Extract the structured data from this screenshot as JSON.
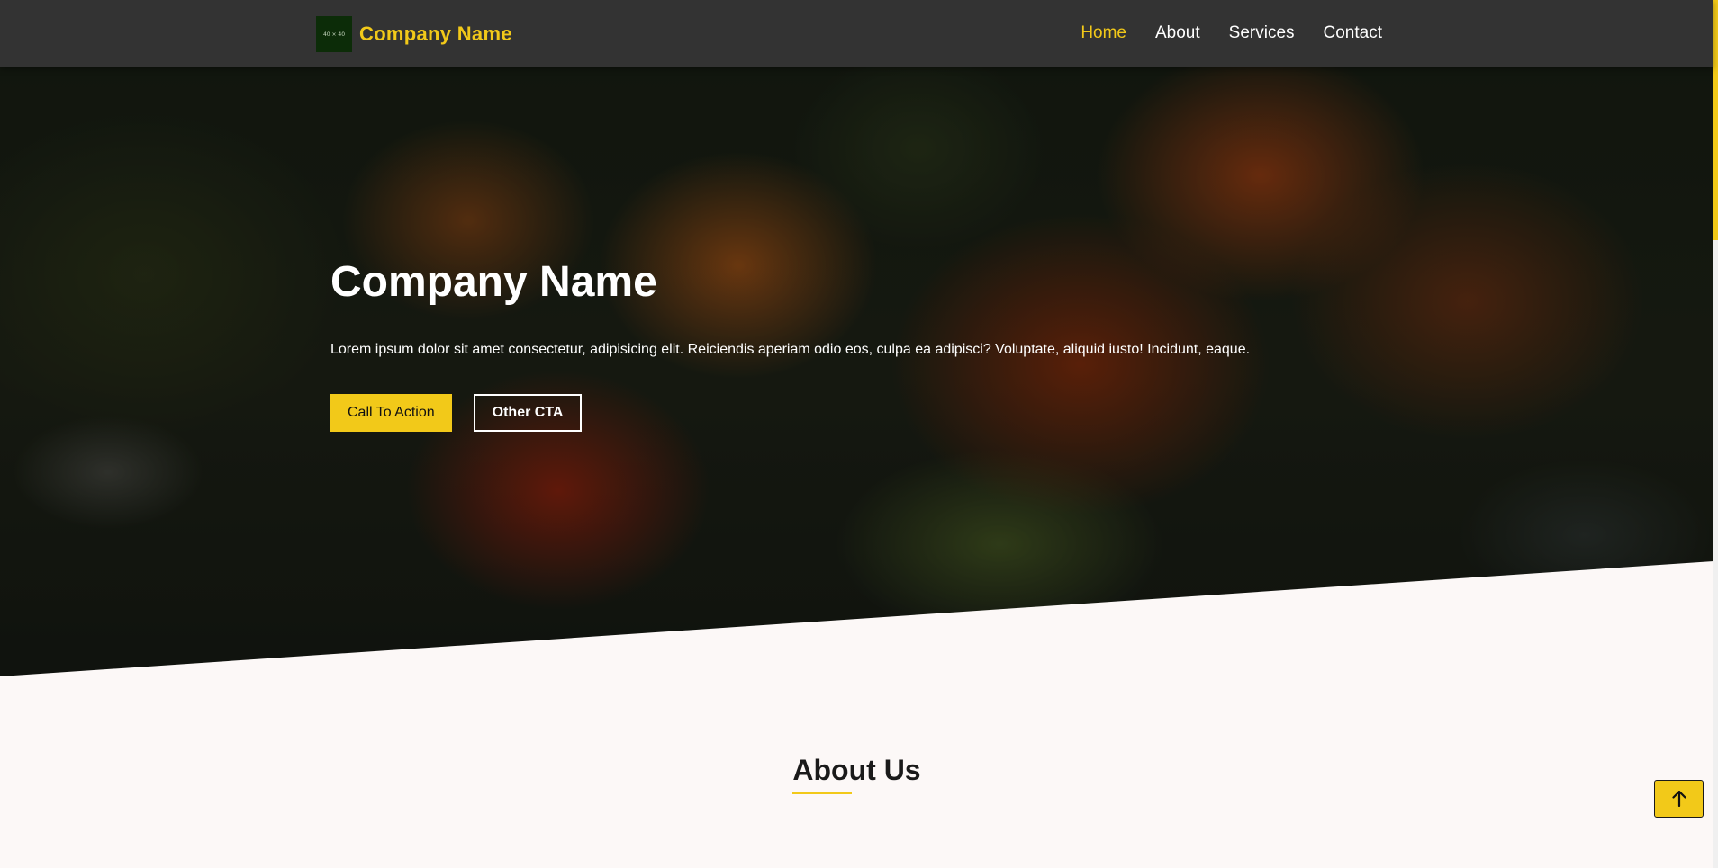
{
  "header": {
    "logo_text": "40 × 40",
    "brand_name": "Company Name",
    "nav": [
      {
        "label": "Home",
        "active": true
      },
      {
        "label": "About",
        "active": false
      },
      {
        "label": "Services",
        "active": false
      },
      {
        "label": "Contact",
        "active": false
      }
    ]
  },
  "hero": {
    "title": "Company Name",
    "description": "Lorem ipsum dolor sit amet consectetur, adipisicing elit. Reiciendis aperiam odio eos, culpa ea adipisci? Voluptate, aliquid iusto! Incidunt, eaque.",
    "primary_cta": "Call To Action",
    "secondary_cta": "Other CTA"
  },
  "about": {
    "heading": "About Us"
  },
  "scroll_top": {
    "icon": "arrow-up-icon"
  },
  "colors": {
    "accent": "#f2c919",
    "navbar": "#333333",
    "page_background": "#fcf8f7"
  }
}
